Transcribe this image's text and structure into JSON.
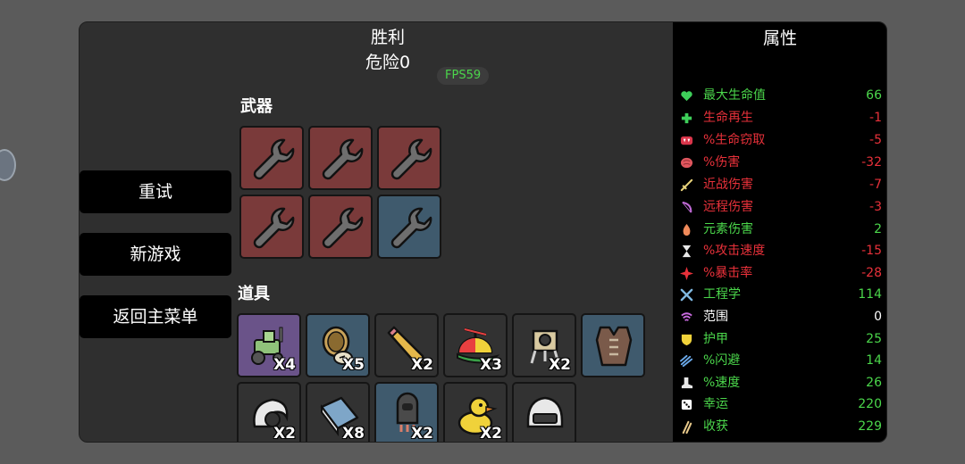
{
  "header": {
    "result": "胜利",
    "danger": "危险0",
    "fps": "FPS59"
  },
  "menu": {
    "retry": "重试",
    "new_game": "新游戏",
    "main_menu": "返回主菜单"
  },
  "weapons": {
    "title": "武器",
    "slots": [
      {
        "icon": "wrench-icon",
        "tier": "red"
      },
      {
        "icon": "wrench-icon",
        "tier": "red"
      },
      {
        "icon": "wrench-icon",
        "tier": "red"
      },
      {
        "icon": "wrench-icon",
        "tier": "red"
      },
      {
        "icon": "wrench-icon",
        "tier": "red"
      },
      {
        "icon": "wrench-icon",
        "tier": "blue"
      }
    ]
  },
  "items": {
    "title": "道具",
    "slots": [
      {
        "icon": "tractor-icon",
        "count": "X4",
        "tier": "purple"
      },
      {
        "icon": "pocket-watch-icon",
        "count": "X5",
        "tier": "blue"
      },
      {
        "icon": "pencil-icon",
        "count": "X2",
        "tier": "gray"
      },
      {
        "icon": "propeller-hat-icon",
        "count": "X3",
        "tier": "gray"
      },
      {
        "icon": "robot-drone-icon",
        "count": "X2",
        "tier": "gray"
      },
      {
        "icon": "vest-icon",
        "count": "",
        "tier": "blue"
      },
      {
        "icon": "snail-shell-icon",
        "count": "X2",
        "tier": "gray"
      },
      {
        "icon": "book-icon",
        "count": "X8",
        "tier": "gray"
      },
      {
        "icon": "capsule-icon",
        "count": "X2",
        "tier": "blue"
      },
      {
        "icon": "rubber-duck-icon",
        "count": "X2",
        "tier": "gray"
      },
      {
        "icon": "helmet-icon",
        "count": "",
        "tier": "gray"
      }
    ]
  },
  "stats": {
    "title": "属性",
    "rows": [
      {
        "label": "最大生命值",
        "value": "66",
        "status": "pos",
        "icon": "heart-icon",
        "color": "#3ecf5a"
      },
      {
        "label": "生命再生",
        "value": "-1",
        "status": "neg",
        "icon": "heal-plus-icon",
        "color": "#3ecf5a"
      },
      {
        "label": "%生命窃取",
        "value": "-5",
        "status": "neg",
        "icon": "vampire-mouth-icon",
        "color": "#d9354a"
      },
      {
        "label": "%伤害",
        "value": "-32",
        "status": "neg",
        "icon": "brain-icon",
        "color": "#e0565e"
      },
      {
        "label": "近战伤害",
        "value": "-7",
        "status": "neg",
        "icon": "sword-icon",
        "color": "#e8d27a"
      },
      {
        "label": "远程伤害",
        "value": "-3",
        "status": "neg",
        "icon": "bow-icon",
        "color": "#c06ad6"
      },
      {
        "label": "元素伤害",
        "value": "2",
        "status": "pos",
        "icon": "flame-icon",
        "color": "#f08a5a"
      },
      {
        "label": "%攻击速度",
        "value": "-15",
        "status": "neg",
        "icon": "hourglass-icon",
        "color": "#e8e8e8"
      },
      {
        "label": "%暴击率",
        "value": "-28",
        "status": "neg",
        "icon": "crit-burst-icon",
        "color": "#e8313a"
      },
      {
        "label": "工程学",
        "value": "114",
        "status": "pos",
        "icon": "wrench-cross-icon",
        "color": "#7fb8e0"
      },
      {
        "label": "范围",
        "value": "0",
        "status": "neu",
        "icon": "range-waves-icon",
        "color": "#c86adf"
      },
      {
        "label": "护甲",
        "value": "25",
        "status": "pos",
        "icon": "shield-icon",
        "color": "#f0d23a"
      },
      {
        "label": "%闪避",
        "value": "14",
        "status": "pos",
        "icon": "dodge-wind-icon",
        "color": "#6aa8e8"
      },
      {
        "label": "%速度",
        "value": "26",
        "status": "pos",
        "icon": "boot-icon",
        "color": "#e8e8e8"
      },
      {
        "label": "幸运",
        "value": "220",
        "status": "pos",
        "icon": "dice-icon",
        "color": "#ffffff"
      },
      {
        "label": "收获",
        "value": "229",
        "status": "pos",
        "icon": "wheat-icon",
        "color": "#e8c98a"
      }
    ]
  }
}
